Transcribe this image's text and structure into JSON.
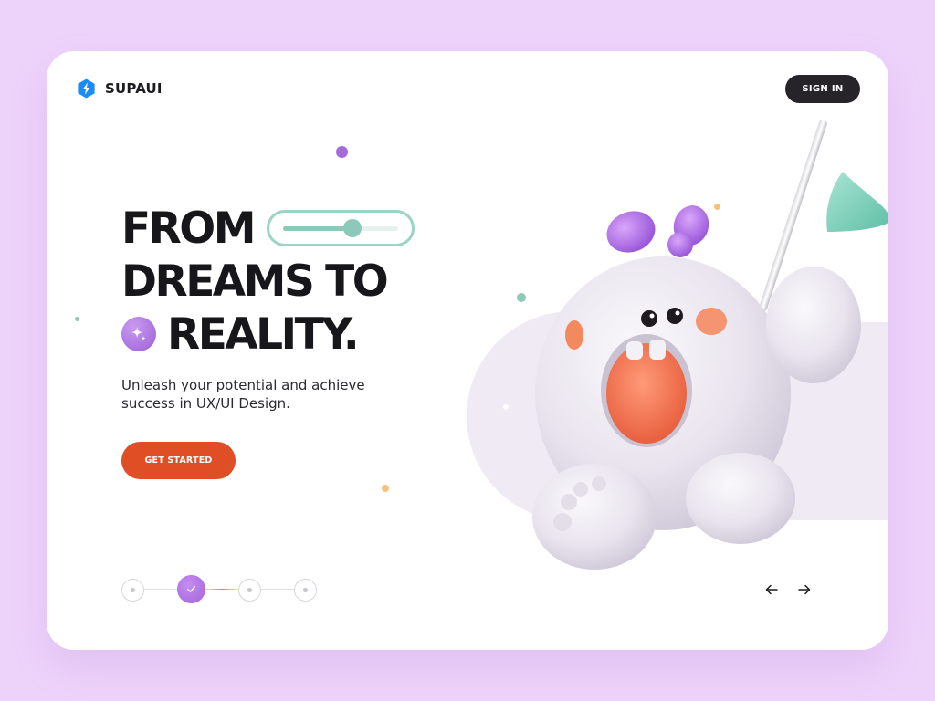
{
  "brand": {
    "name": "SUPAUI",
    "logo_icon": "lightning-hexagon-icon",
    "logo_color": "#1C8CF2"
  },
  "header": {
    "signin_label": "SIGN IN"
  },
  "hero": {
    "line1": "FROM",
    "line2": "DREAMS TO",
    "line3": "REALITY.",
    "slider_value": 0.6,
    "sparkle_icon": "sparkle-icon",
    "subtitle": "Unleash your potential and achieve success in UX/UI Design.",
    "cta_label": "GET STARTED"
  },
  "stepper": {
    "total_steps": 4,
    "current_step": 2,
    "check_icon": "check-icon"
  },
  "carousel": {
    "prev_icon": "arrow-left-icon",
    "next_icon": "arrow-right-icon"
  },
  "colors": {
    "background": "#EDD3FA",
    "card": "#FFFFFF",
    "accent_orange": "#E04E26",
    "accent_purple": "#A163DA",
    "accent_mint": "#8CC9B9",
    "dark": "#262429"
  }
}
